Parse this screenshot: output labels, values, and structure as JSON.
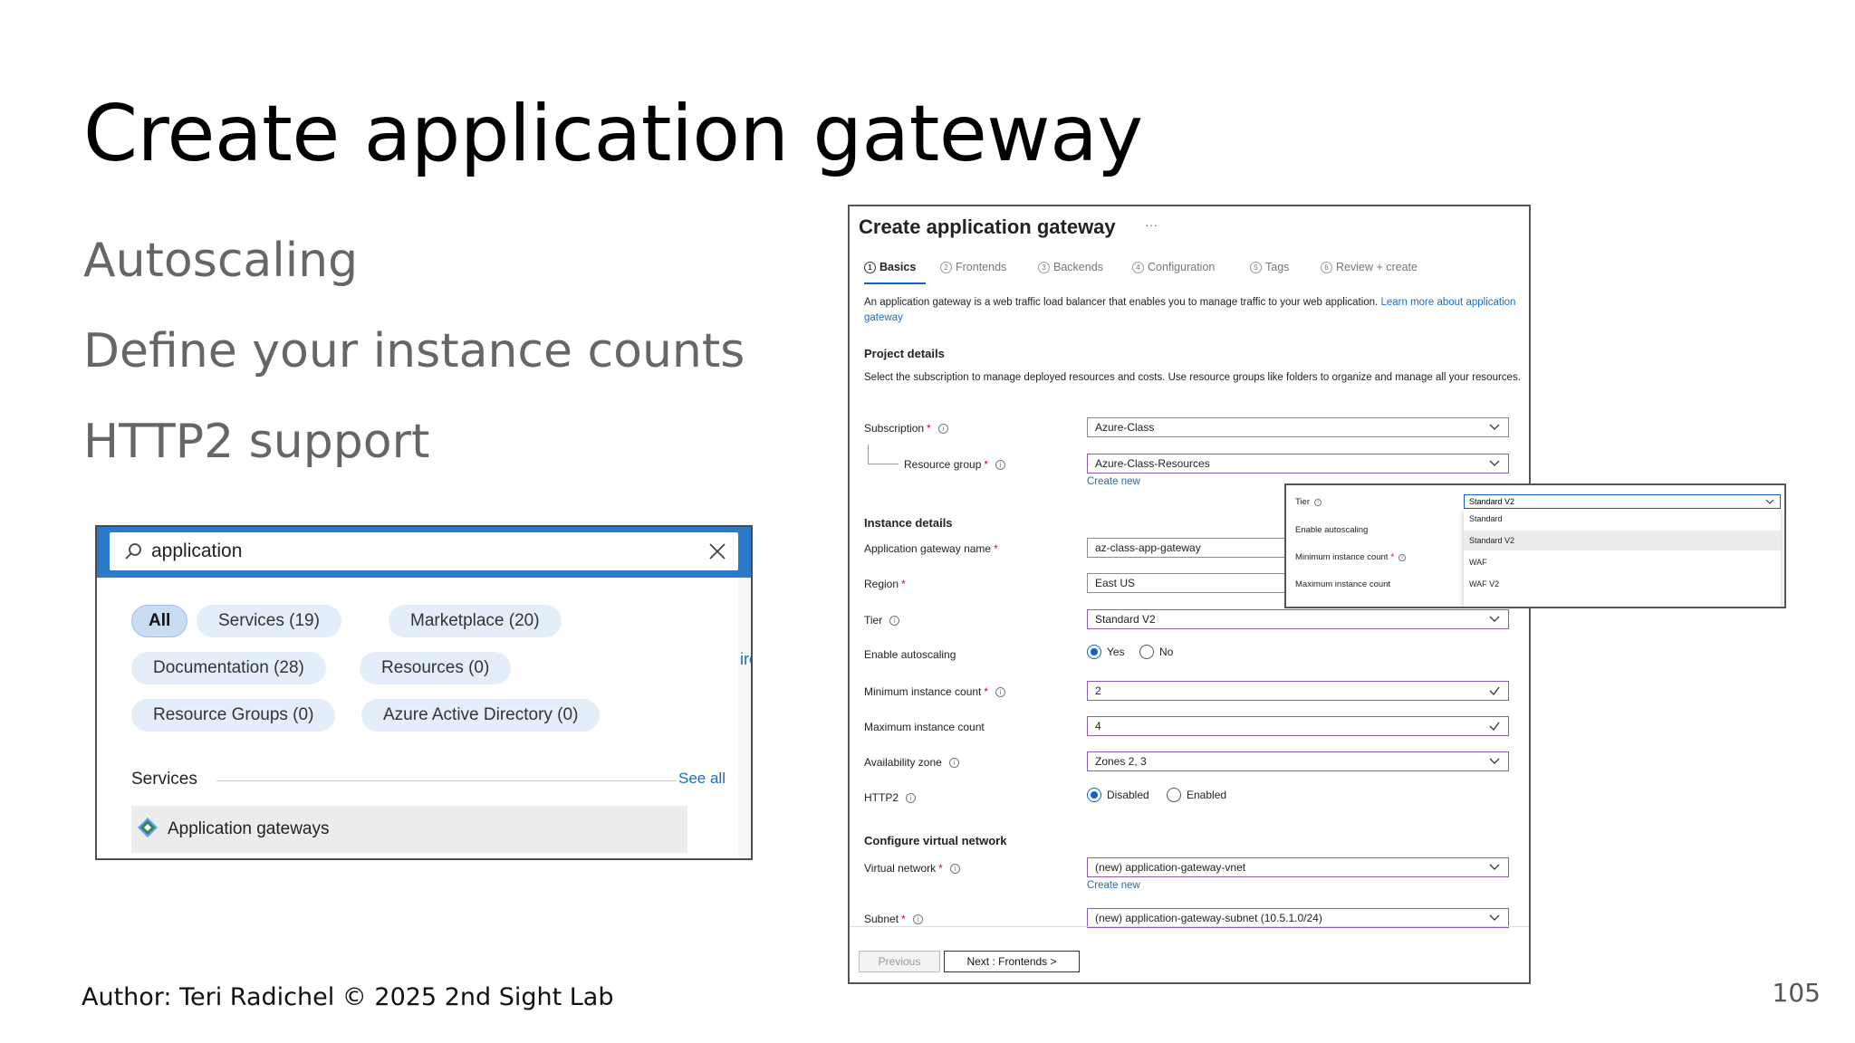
{
  "slide": {
    "title": "Create application gateway",
    "bullets": [
      "Autoscaling",
      "Define your instance counts",
      "HTTP2 support"
    ],
    "author": "Author: Teri Radichel © 2025 2nd Sight Lab",
    "page_number": "105"
  },
  "search_screenshot": {
    "query": "application",
    "chips": [
      "All",
      "Services  (19)",
      "Marketplace  (20)",
      "Documentation  (28)",
      "Resources  (0)",
      "Resource Groups  (0)",
      "Azure Active Directory  (0)"
    ],
    "services_heading": "Services",
    "see_all": "See all",
    "result": "Application gateways",
    "edge_text": "ire"
  },
  "portal": {
    "title": "Create application gateway",
    "ellipsis": "···",
    "tabs": [
      {
        "num": "1",
        "label": "Basics"
      },
      {
        "num": "2",
        "label": "Frontends"
      },
      {
        "num": "3",
        "label": "Backends"
      },
      {
        "num": "4",
        "label": "Configuration"
      },
      {
        "num": "5",
        "label": "Tags"
      },
      {
        "num": "6",
        "label": "Review + create"
      }
    ],
    "intro": "An application gateway is a web traffic load balancer that enables you to manage traffic to your web application.",
    "intro_link": "Learn more about application gateway",
    "project_details": "Project details",
    "project_desc": "Select the subscription to manage deployed resources and costs. Use resource groups like folders to organize and manage all your resources.",
    "subscription_label": "Subscription",
    "subscription_value": "Azure-Class",
    "resource_group_label": "Resource group",
    "resource_group_value": "Azure-Class-Resources",
    "create_new": "Create new",
    "instance_details": "Instance details",
    "gateway_name_label": "Application gateway name",
    "gateway_name_value": "az-class-app-gateway",
    "region_label": "Region",
    "region_value": "East US",
    "tier_label": "Tier",
    "tier_value": "Standard V2",
    "autoscaling_label": "Enable autoscaling",
    "autoscaling_yes": "Yes",
    "autoscaling_no": "No",
    "min_label": "Minimum instance count",
    "min_value": "2",
    "max_label": "Maximum instance count",
    "max_value": "4",
    "az_label": "Availability zone",
    "az_value": "Zones 2, 3",
    "http2_label": "HTTP2",
    "http2_disabled": "Disabled",
    "http2_enabled": "Enabled",
    "vnet_section": "Configure virtual network",
    "vnet_label": "Virtual network",
    "vnet_value": "(new) application-gateway-vnet",
    "subnet_label": "Subnet",
    "subnet_value": "(new) application-gateway-subnet (10.5.1.0/24)",
    "prev_button": "Previous",
    "next_button": "Next : Frontends >"
  },
  "tier_dropdown": {
    "tier_label": "Tier",
    "autoscaling_label": "Enable autoscaling",
    "min_label": "Minimum instance count",
    "max_label": "Maximum instance count",
    "selected": "Standard V2",
    "options": [
      "Standard",
      "Standard V2",
      "WAF",
      "WAF V2"
    ]
  }
}
